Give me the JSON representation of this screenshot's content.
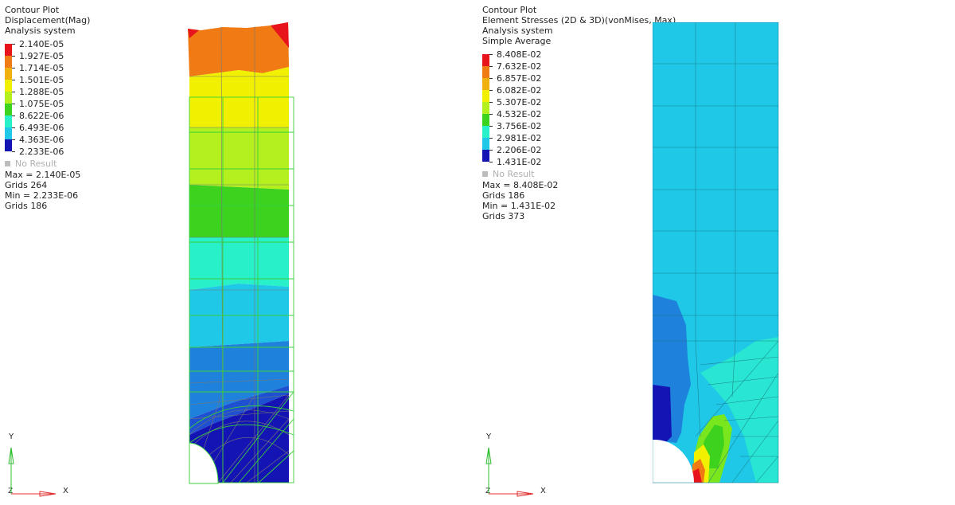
{
  "left": {
    "title_lines": [
      "Contour Plot",
      "Displacement(Mag)",
      "Analysis system"
    ],
    "scale_values": [
      "2.140E-05",
      "1.927E-05",
      "1.714E-05",
      "1.501E-05",
      "1.288E-05",
      "1.075E-05",
      "8.622E-06",
      "6.493E-06",
      "4.363E-06",
      "2.233E-06"
    ],
    "no_result": "No Result",
    "stats": [
      "Max = 2.140E-05",
      "Grids 264",
      "Min = 2.233E-06",
      "Grids 186"
    ]
  },
  "right": {
    "title_lines": [
      "Contour Plot",
      "Element Stresses (2D & 3D)(vonMises, Max)",
      "Analysis system",
      "Simple Average"
    ],
    "scale_values": [
      "8.408E-02",
      "7.632E-02",
      "6.857E-02",
      "6.082E-02",
      "5.307E-02",
      "4.532E-02",
      "3.756E-02",
      "2.981E-02",
      "2.206E-02",
      "1.431E-02"
    ],
    "no_result": "No Result",
    "stats": [
      "Max = 8.408E-02",
      "Grids 186",
      "Min = 1.431E-02",
      "Grids 373"
    ]
  },
  "palette": [
    "#e8141c",
    "#f07a14",
    "#f0b010",
    "#f0f000",
    "#b4f01e",
    "#3cd21e",
    "#28f0c8",
    "#1ec8e6",
    "#1e82dc",
    "#1414b4"
  ],
  "axis_labels": {
    "y": "Y",
    "x": "X",
    "z": "Z"
  }
}
